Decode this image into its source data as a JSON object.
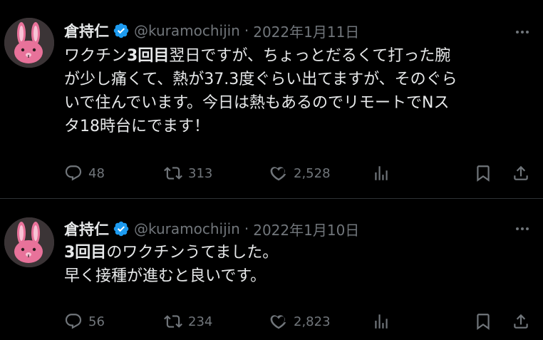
{
  "tweets": [
    {
      "author": "倉持仁",
      "handle": "@kuramochijin",
      "separator": "·",
      "date": "2022年1月11日",
      "body_lines": [
        [
          "ワクチン",
          "3回目",
          "翌日ですが、ちょっとだるくて打った腕"
        ],
        [
          "が少し痛くて、熱が37.3度ぐらい出てますが、そのぐら"
        ],
        [
          "いで住んでいます。今日は熱もあるのでリモートでNス"
        ],
        [
          "タ18時台にでます！"
        ]
      ],
      "replies": "48",
      "retweets": "313",
      "likes": "2,528"
    },
    {
      "author": "倉持仁",
      "handle": "@kuramochijin",
      "separator": "·",
      "date": "2022年1月10日",
      "body_lines": [
        [
          "3回目",
          "のワクチンうてました。"
        ],
        [
          "早く接種が進むと良いです。"
        ]
      ],
      "replies": "56",
      "retweets": "234",
      "likes": "2,823"
    }
  ],
  "colors": {
    "background": "#000000",
    "text": "#e7e9ea",
    "secondary": "#71767b",
    "divider": "#2f3336",
    "verified": "#1d9bf0",
    "avatar_bunny": "#e8729a"
  },
  "icons": [
    "verified-badge-icon",
    "more-icon",
    "reply-icon",
    "retweet-icon",
    "like-icon",
    "views-icon",
    "bookmark-icon",
    "share-icon",
    "avatar-bunny"
  ]
}
